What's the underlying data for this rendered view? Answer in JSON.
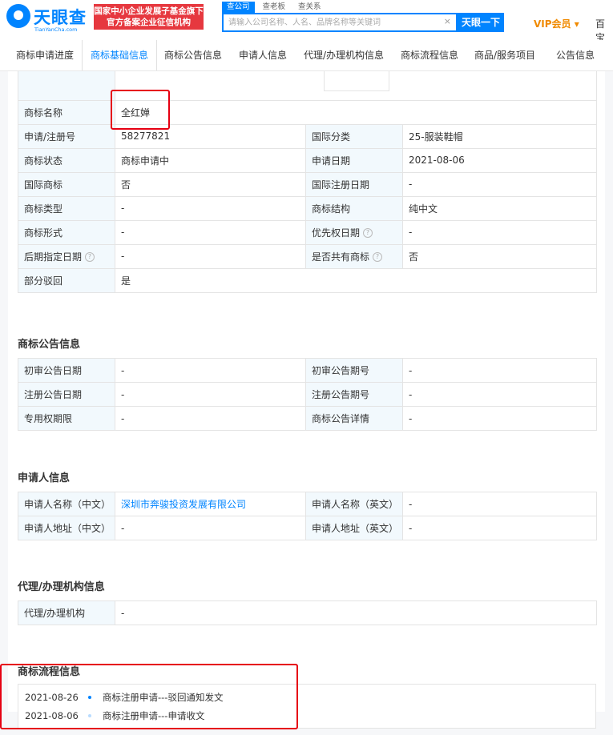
{
  "header": {
    "logo_text": "天眼查",
    "logo_sub": "TianYanCha.com",
    "banner_line1": "国家中小企业发展子基金旗下",
    "banner_line2": "官方备案企业征信机构",
    "search_tabs": [
      "查公司",
      "查老板",
      "查关系"
    ],
    "search_placeholder": "请输入公司名称、人名、品牌名称等关键词",
    "clear_icon": "×",
    "search_button": "天眼一下",
    "vip": "VIP会员 ▾",
    "more": "百宝"
  },
  "tabs": [
    "商标申请进度",
    "商标基础信息",
    "商标公告信息",
    "申请人信息",
    "代理/办理机构信息",
    "商标流程信息",
    "商品/服务项目",
    "公告信息"
  ],
  "basic": {
    "rows": [
      {
        "k1": "商标名称",
        "v1": "全红婵"
      },
      {
        "k1": "申请/注册号",
        "v1": "58277821",
        "k2": "国际分类",
        "v2": "25-服装鞋帽"
      },
      {
        "k1": "商标状态",
        "v1": "商标申请中",
        "k2": "申请日期",
        "v2": "2021-08-06"
      },
      {
        "k1": "国际商标",
        "v1": "否",
        "k2": "国际注册日期",
        "v2": "-"
      },
      {
        "k1": "商标类型",
        "v1": "-",
        "k2": "商标结构",
        "v2": "纯中文"
      },
      {
        "k1": "商标形式",
        "v1": "-",
        "k2": "优先权日期",
        "v2": "-"
      },
      {
        "k1": "后期指定日期",
        "v1": "-",
        "k2": "是否共有商标",
        "v2": "否"
      },
      {
        "k1": "部分驳回",
        "v1": "是"
      }
    ]
  },
  "announce": {
    "title": "商标公告信息",
    "rows": [
      {
        "k1": "初审公告日期",
        "v1": "-",
        "k2": "初审公告期号",
        "v2": "-"
      },
      {
        "k1": "注册公告日期",
        "v1": "-",
        "k2": "注册公告期号",
        "v2": "-"
      },
      {
        "k1": "专用权期限",
        "v1": "-",
        "k2": "商标公告详情",
        "v2": "-"
      }
    ]
  },
  "applicant": {
    "title": "申请人信息",
    "rows": [
      {
        "k1": "申请人名称（中文）",
        "v1": "深圳市奔骏投资发展有限公司",
        "k2": "申请人名称（英文）",
        "v2": "-"
      },
      {
        "k1": "申请人地址（中文）",
        "v1": "-",
        "k2": "申请人地址（英文）",
        "v2": "-"
      }
    ]
  },
  "agent": {
    "title": "代理/办理机构信息",
    "rows": [
      {
        "k1": "代理/办理机构",
        "v1": "-"
      }
    ]
  },
  "flow": {
    "title": "商标流程信息",
    "items": [
      {
        "date": "2021-08-26",
        "text": "商标注册申请---驳回通知发文",
        "dot_color": "#0084ff"
      },
      {
        "date": "2021-08-06",
        "text": "商标注册申请---申请收文",
        "dot_color": "#b8dcff"
      }
    ]
  },
  "colors": {
    "accent": "#0084ff",
    "highlight": "#e60012",
    "vip": "#f08a00"
  }
}
